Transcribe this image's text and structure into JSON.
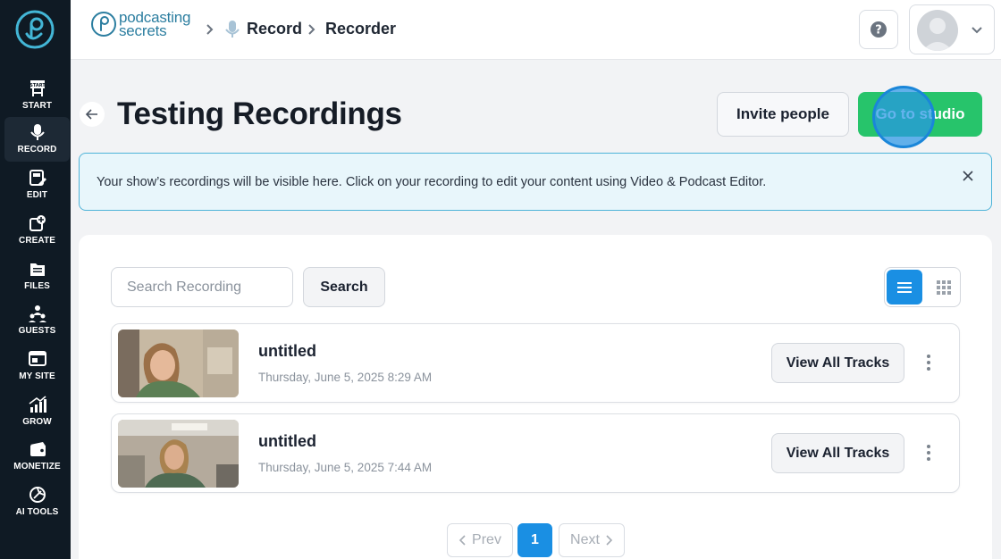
{
  "sidebar": {
    "items": [
      {
        "label": "START",
        "icon": "start-sign-icon"
      },
      {
        "label": "RECORD",
        "icon": "microphone-icon",
        "active": true
      },
      {
        "label": "EDIT",
        "icon": "edit-film-icon"
      },
      {
        "label": "CREATE",
        "icon": "create-icon"
      },
      {
        "label": "FILES",
        "icon": "files-icon"
      },
      {
        "label": "GUESTS",
        "icon": "guests-icon"
      },
      {
        "label": "MY SITE",
        "icon": "my-site-icon"
      },
      {
        "label": "GROW",
        "icon": "grow-chart-icon"
      },
      {
        "label": "MONETIZE",
        "icon": "monetize-icon"
      },
      {
        "label": "AI TOOLS",
        "icon": "ai-tools-icon"
      }
    ]
  },
  "header": {
    "brand_line1": "podcasting",
    "brand_line2": "secrets",
    "breadcrumb": [
      "Record",
      "Recorder"
    ],
    "help_icon": "question-circle-icon",
    "profile_chevron": "chevron-down-icon"
  },
  "page": {
    "title": "Testing Recordings",
    "invite_label": "Invite people",
    "studio_label": "Go to studio"
  },
  "banner": {
    "text": "Your show’s recordings will be visible here. Click on your recording to edit your content using Video & Podcast Editor."
  },
  "search": {
    "placeholder": "Search Recording",
    "value": "",
    "button_label": "Search"
  },
  "recordings": [
    {
      "title": "untitled",
      "date": "Thursday, June 5, 2025 8:29 AM",
      "tracks_label": "View All Tracks"
    },
    {
      "title": "untitled",
      "date": "Thursday, June 5, 2025 7:44 AM",
      "tracks_label": "View All Tracks"
    }
  ],
  "pagination": {
    "prev": "Prev",
    "current": "1",
    "next": "Next"
  },
  "colors": {
    "sidebar_bg": "#0f1a24",
    "primary": "#1a8fe3",
    "studio_green": "#27c46b",
    "brand_teal": "#2c7ea0"
  }
}
